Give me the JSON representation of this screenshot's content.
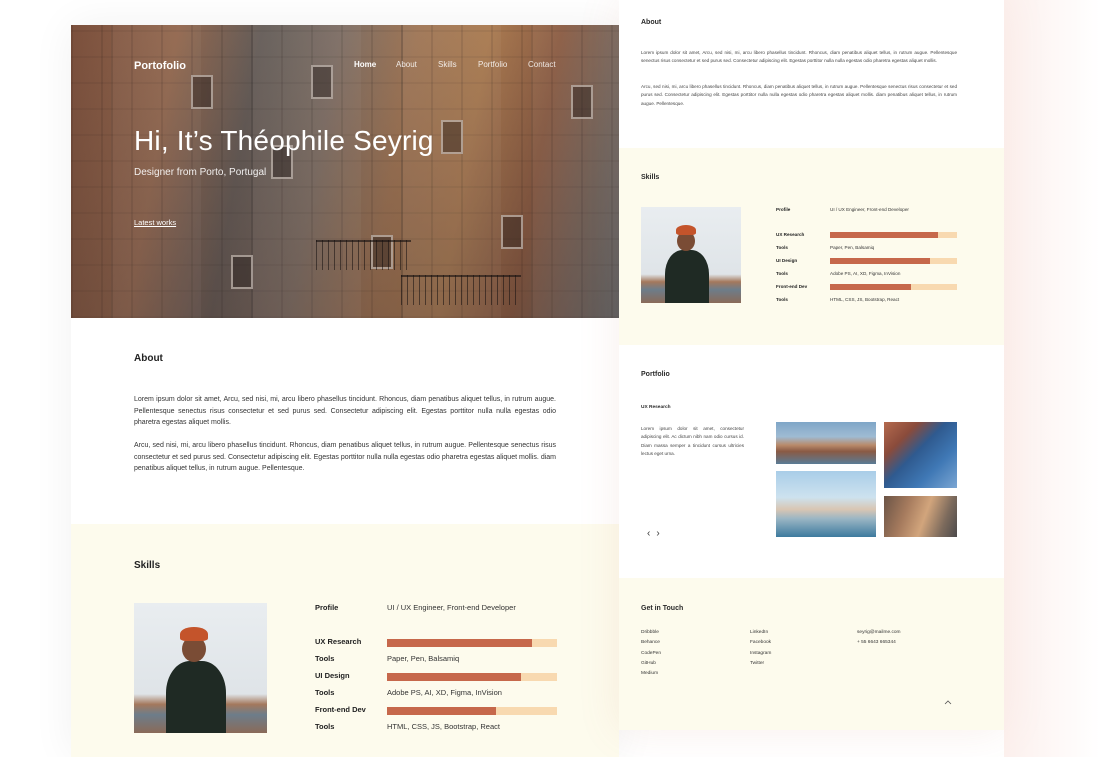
{
  "hero": {
    "brand": "Portofolio",
    "nav": [
      "Home",
      "About",
      "Skills",
      "Portfolio",
      "Contact"
    ],
    "active_nav": "Home",
    "title": "Hi, It’s Théophile Seyrig",
    "subtitle": "Designer from Porto, Portugal",
    "cta": "Latest works"
  },
  "about": {
    "heading": "About",
    "p1": "Lorem ipsum dolor sit amet, Arcu, sed nisi, mi, arcu libero phasellus tincidunt. Rhoncus, diam penatibus aliquet tellus, in rutrum augue. Pellentesque senectus risus consectetur et sed purus sed. Consectetur adipiscing elit. Egestas porttitor nulla nulla egestas odio pharetra egestas aliquet mollis.",
    "p2": "Arcu, sed nisi, mi, arcu libero phasellus tincidunt. Rhoncus, diam penatibus aliquet tellus, in rutrum augue. Pellentesque senectus risus consectetur et sed purus sed. Consectetur adipiscing elit. Egestas porttitor nulla nulla egestas odio pharetra egestas aliquet mollis. diam penatibus aliquet tellus, in rutrum augue. Pellentesque."
  },
  "skills": {
    "heading": "Skills",
    "profile_label": "Profile",
    "profile_value": "UI / UX Engineer, Front-end Developer",
    "items": [
      {
        "name": "UX Research",
        "level": 0.85,
        "tools_label": "Tools",
        "tools": "Paper, Pen, Balsamiq"
      },
      {
        "name": "UI Design",
        "level": 0.79,
        "tools_label": "Tools",
        "tools": "Adobe PS, AI, XD, Figma, InVision"
      },
      {
        "name": "Front-end Dev",
        "level": 0.64,
        "tools_label": "Tools",
        "tools": "HTML, CSS, JS, Bootstrap, React"
      }
    ],
    "bar_fill_color": "#c6684b",
    "bar_track_color": "#f8d9b0"
  },
  "portfolio": {
    "heading": "Portfolio",
    "item_title": "UX Research",
    "item_text": "Lorem ipsum dolor sit amet, consectetur adipiscing elit. Ac dictum nibh nam odio cursus id. Diam massa semper a tincidunt cursus ultricies lectus eget urna."
  },
  "contact": {
    "heading": "Get in Touch",
    "col1": [
      "Dribbble",
      "Behance",
      "CodePen",
      "GitHub",
      "Medium"
    ],
    "col2": [
      "LinkedIn",
      "Facebook",
      "Instagram",
      "Twitter"
    ],
    "col3": [
      "seyrig@mailme.com",
      "+ 55 6643 665344"
    ]
  },
  "colors": {
    "accent": "#c6684b",
    "section_bg": "#fdfbed"
  }
}
